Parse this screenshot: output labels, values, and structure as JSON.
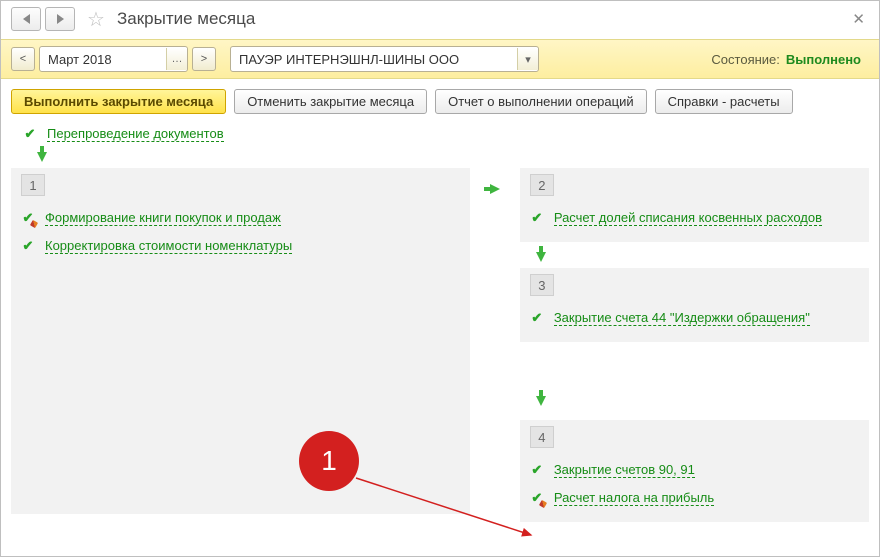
{
  "header": {
    "title": "Закрытие месяца"
  },
  "toolbar": {
    "period": "Март 2018",
    "organization": "ПАУЭР ИНТЕРНЭШНЛ-ШИНЫ ООО",
    "state_label": "Состояние:",
    "state_value": "Выполнено"
  },
  "actions": {
    "perform": "Выполнить закрытие месяца",
    "cancel": "Отменить закрытие месяца",
    "report": "Отчет о выполнении операций",
    "refs": "Справки - расчеты"
  },
  "top_link": "Перепроведение документов",
  "stage1": {
    "num": "1",
    "item1": "Формирование книги покупок и продаж",
    "item2": "Корректировка стоимости номенклатуры"
  },
  "stage2": {
    "num": "2",
    "item1": "Расчет долей списания косвенных расходов"
  },
  "stage3": {
    "num": "3",
    "item1": "Закрытие счета 44 \"Издержки обращения\""
  },
  "stage4": {
    "num": "4",
    "item1": "Закрытие счетов 90, 91",
    "item2": "Расчет налога на прибыль"
  },
  "annotation": {
    "label": "1"
  }
}
